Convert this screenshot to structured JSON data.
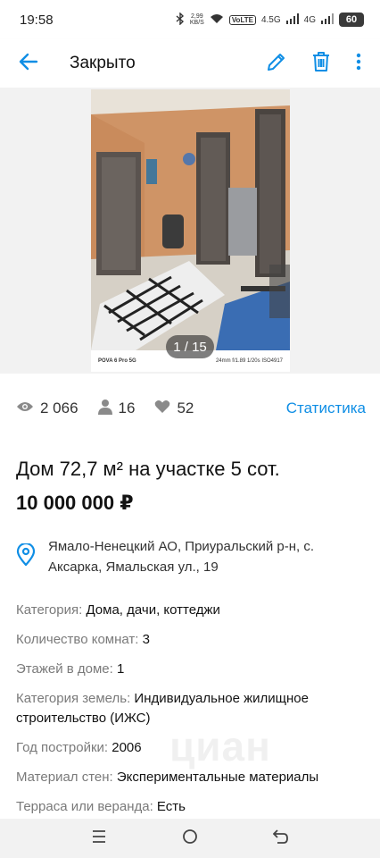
{
  "status_bar": {
    "time": "19:58",
    "net_speed": "2,99\nKB/S",
    "volte": "VoLTE",
    "sim1": "4.5G",
    "sim2": "4G",
    "battery": "60"
  },
  "app_bar": {
    "title": "Закрыто",
    "icons": [
      "arrow-back-icon",
      "edit-icon",
      "trash-icon",
      "more-vert-icon"
    ]
  },
  "gallery": {
    "counter": "1 / 15",
    "camera_label": "POVA 6 Pro 5G",
    "camera_meta": "24mm f/1.89 1/20s ISO4917"
  },
  "stats": {
    "views": "2 066",
    "contacts": "16",
    "favorites": "52",
    "statistics_link": "Статистика"
  },
  "listing": {
    "title": "Дом 72,7 м² на участке 5 сот.",
    "price": "10 000 000 ₽",
    "address": "Ямало-Ненецкий АО, Приуральский р-н, с. Аксарка, Ямальская ул., 19"
  },
  "params": [
    {
      "key": "Категория:",
      "value": "Дома, дачи, коттеджи"
    },
    {
      "key": "Количество комнат:",
      "value": "3"
    },
    {
      "key": "Этажей в доме:",
      "value": "1"
    },
    {
      "key": "Категория земель:",
      "value": "Индивидуальное жилищное строительство (ИЖС)"
    },
    {
      "key": "Год постройки:",
      "value": "2006"
    },
    {
      "key": "Материал стен:",
      "value": "Экспериментальные материалы"
    },
    {
      "key": "Терраса или веранда:",
      "value": "Есть"
    }
  ],
  "watermark": "циан",
  "colors": {
    "accent": "#0f8ee5",
    "text": "#121212",
    "muted": "#7a7a7a"
  }
}
